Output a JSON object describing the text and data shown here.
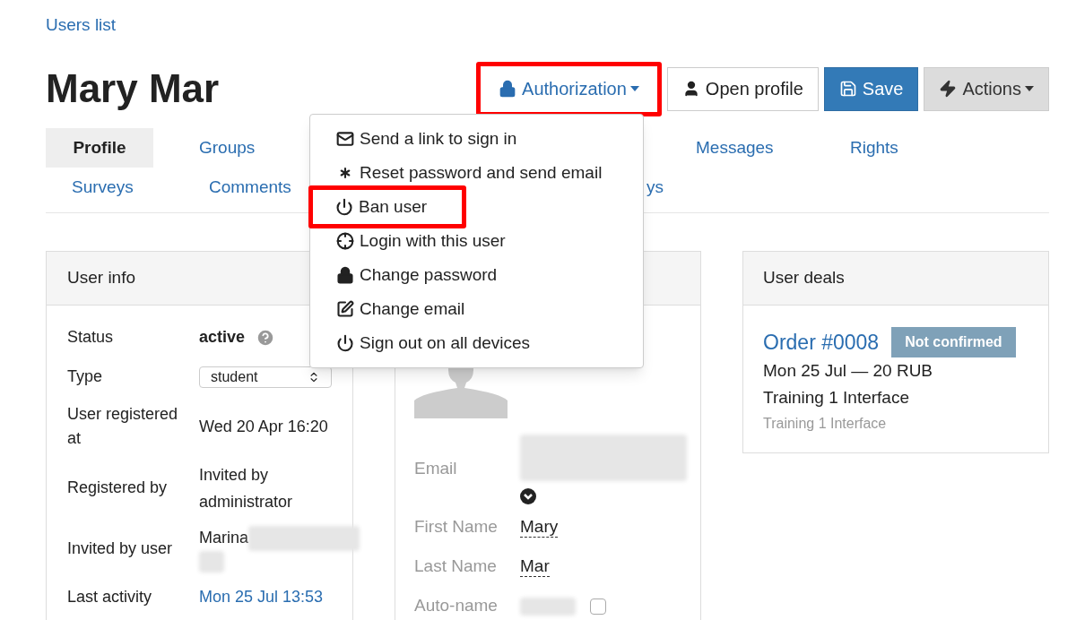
{
  "breadcrumb": "Users list",
  "title": "Mary Mar",
  "toolbar": [
    {
      "kind": "lock",
      "label": "Authorization",
      "caret": true,
      "highlighted": true
    },
    {
      "kind": "user",
      "label": "Open profile",
      "caret": false,
      "highlighted": false
    },
    {
      "kind": "save",
      "label": "Save",
      "caret": false,
      "highlighted": false
    },
    {
      "kind": "bolt",
      "label": "Actions",
      "caret": true,
      "highlighted": false
    }
  ],
  "tabs": [
    [
      {
        "label": "Profile",
        "selected": true
      },
      {
        "label": "Groups",
        "selected": false
      },
      {
        "label": "Messages",
        "selected": false
      },
      {
        "label": "Rights",
        "selected": false
      }
    ],
    [
      {
        "label": "Surveys",
        "selected": false
      },
      {
        "label": "Comments",
        "selected": false
      },
      {
        "label": "ys",
        "selected": false
      }
    ]
  ],
  "menu": [
    {
      "kind": "envelope",
      "label": "Send a link to sign in",
      "highlighted": false
    },
    {
      "kind": "asterisk",
      "label": "Reset password and send email",
      "highlighted": false
    },
    {
      "kind": "power",
      "label": "Ban user",
      "highlighted": true
    },
    {
      "kind": "crosshair",
      "label": "Login with this user",
      "highlighted": false
    },
    {
      "kind": "lock",
      "label": "Change password",
      "highlighted": false
    },
    {
      "kind": "edit",
      "label": "Change email",
      "highlighted": false
    },
    {
      "kind": "power",
      "label": "Sign out on all devices",
      "highlighted": false
    }
  ],
  "user_info": {
    "title": "User info",
    "rows": [
      {
        "kind": "status",
        "label": "Status",
        "value": "active"
      },
      {
        "kind": "select",
        "label": "Type",
        "value": "student"
      },
      {
        "kind": "text",
        "label": "User registered at",
        "value": "Wed 20 Apr 16:20"
      },
      {
        "kind": "text",
        "label": "Registered by",
        "value": "Invited by administrator"
      },
      {
        "kind": "blurred",
        "label": "Invited by user",
        "value": "Marina"
      },
      {
        "kind": "link",
        "label": "Last activity",
        "value": "Mon 25 Jul 13:53"
      }
    ]
  },
  "profile_fields": [
    {
      "kind": "email",
      "label": "Email"
    },
    {
      "kind": "name",
      "label": "First Name",
      "value": "Mary"
    },
    {
      "kind": "name",
      "label": "Last Name",
      "value": "Mar"
    },
    {
      "kind": "autoname",
      "label": "Auto-name",
      "checked": false
    }
  ],
  "user_deals": {
    "title": "User deals",
    "order": "Order #0008",
    "badge": "Not confirmed",
    "lines": [
      "Mon 25 Jul — 20 RUB",
      "Training 1 Interface"
    ],
    "note": "Training 1 Interface"
  }
}
